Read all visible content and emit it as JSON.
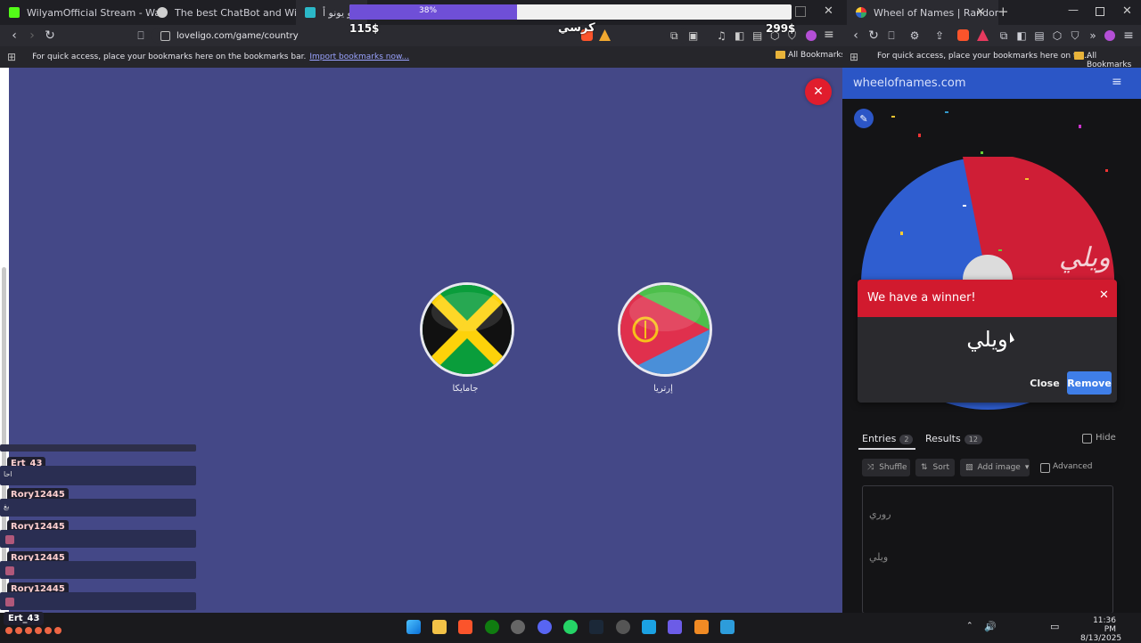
{
  "left_browser": {
    "tabs": [
      {
        "title": "WilyamOfficial Stream - Watch Live o",
        "color": "#53fc18"
      },
      {
        "title": "The best ChatBot and Widgets for Ki",
        "color": "#cfcfcf"
      },
      {
        "title": "جو يونو أ",
        "color": "#2bb8c8"
      }
    ],
    "url": "loveligo.com/game/country",
    "bookmarks_hint": "For quick access, place your bookmarks here on the bookmarks bar.",
    "bookmarks_import": "Import bookmarks now...",
    "all_bookmarks": "All Bookmarks"
  },
  "overlay": {
    "progress_label": "38%",
    "progress": 0.38,
    "amount_left": "115$",
    "amount_right": "299$",
    "label_center": "كرسي"
  },
  "game": {
    "close_symbol": "✕",
    "options": [
      {
        "name": "جامايكا",
        "flag": "jamaica"
      },
      {
        "name": "إرتريا",
        "flag": "eritrea"
      }
    ]
  },
  "chat": {
    "messages": [
      {
        "user": "Ert_43",
        "text": "احا"
      },
      {
        "user": "Rory12445",
        "text": "بغ"
      },
      {
        "user": "Rory12445",
        "text": ""
      },
      {
        "user": "Rory12445",
        "text": ""
      },
      {
        "user": "Rory12445",
        "text": ""
      }
    ],
    "footer_user": "Ert_43"
  },
  "right_browser": {
    "tab_title": "Wheel of Names | Random na",
    "bookmarks_hint": "For quick access, place your bookmarks here on th...",
    "all_bookmarks": "All Bookmarks",
    "site_name": "wheelofnames.com",
    "wheel_label": "ويلي",
    "modal": {
      "title": "We have a winner!",
      "winner": "ويلي",
      "close_label": "Close",
      "remove_label": "Remove"
    },
    "tabs": {
      "entries_label": "Entries",
      "entries_count": "2",
      "results_label": "Results",
      "results_count": "12",
      "hide_label": "Hide"
    },
    "toolbar": {
      "shuffle": "Shuffle",
      "sort": "Sort",
      "add_image": "Add image",
      "advanced": "Advanced"
    },
    "entries": [
      "روري",
      "ويلي"
    ]
  },
  "taskbar": {
    "time": "11:36 PM",
    "date": "8/13/2025"
  },
  "colors": {
    "game_bg": "#444887",
    "modal_red": "#d11a2e",
    "remove_blue": "#3f7ee8",
    "wheel_blue": "#2b56c6"
  }
}
